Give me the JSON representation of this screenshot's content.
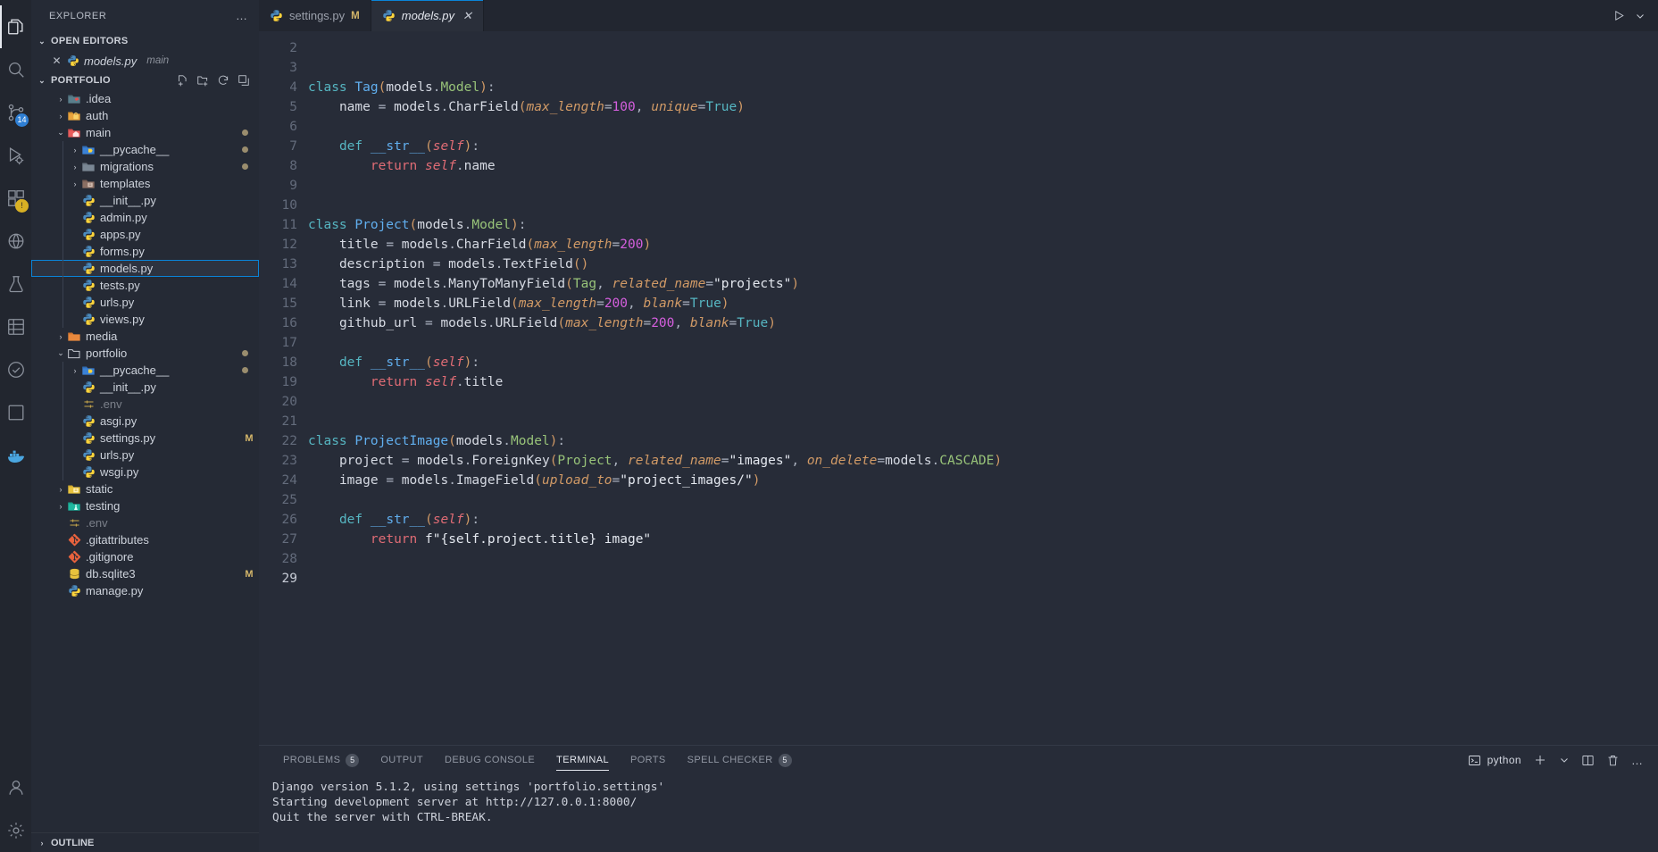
{
  "activity_bar": {
    "items": [
      {
        "name": "explorer",
        "icon": "files-icon",
        "badge": null,
        "active": true
      },
      {
        "name": "search",
        "icon": "search-icon",
        "badge": null,
        "active": false
      },
      {
        "name": "source-control",
        "icon": "source-control-icon",
        "badge": "14",
        "active": false
      },
      {
        "name": "run-and-debug",
        "icon": "run-debug-icon",
        "badge": null,
        "active": false
      },
      {
        "name": "extensions",
        "icon": "extensions-icon",
        "badge": "!",
        "active": false
      },
      {
        "name": "remote-explorer",
        "icon": "remote-explorer-icon",
        "badge": null,
        "active": false
      },
      {
        "name": "testing",
        "icon": "beaker-icon",
        "badge": null,
        "active": false
      },
      {
        "name": "database",
        "icon": "database-icon",
        "badge": null,
        "active": false
      },
      {
        "name": "todo-tree",
        "icon": "check-circle-icon",
        "badge": null,
        "active": false
      },
      {
        "name": "layout",
        "icon": "square-icon",
        "badge": null,
        "active": false
      },
      {
        "name": "docker",
        "icon": "docker-icon",
        "badge": null,
        "active": false
      }
    ],
    "bottom_items": [
      {
        "name": "accounts",
        "icon": "account-icon"
      },
      {
        "name": "settings",
        "icon": "gear-icon"
      }
    ]
  },
  "sidebar": {
    "title": "EXPLORER",
    "more_actions": "…",
    "open_editors": {
      "label": "OPEN EDITORS",
      "items": [
        {
          "close": "✕",
          "icon": "python-icon",
          "name": "models.py",
          "description": "main"
        }
      ]
    },
    "workspace": {
      "label": "PORTFOLIO",
      "actions": [
        "new-file-icon",
        "new-folder-icon",
        "refresh-icon",
        "collapse-all-icon"
      ],
      "tree": [
        {
          "indent": 1,
          "twisty": "›",
          "icon": "folder-idea",
          "label": ".idea",
          "mark": "",
          "dot": false,
          "dim": false,
          "selected": false
        },
        {
          "indent": 1,
          "twisty": "›",
          "icon": "folder-auth",
          "label": "auth",
          "mark": "",
          "dot": false,
          "dim": false,
          "selected": false
        },
        {
          "indent": 1,
          "twisty": "⌄",
          "icon": "folder-main",
          "label": "main",
          "mark": "",
          "dot": true,
          "dim": false,
          "selected": false
        },
        {
          "indent": 2,
          "twisty": "›",
          "icon": "folder-pycache",
          "label": "__pycache__",
          "mark": "",
          "dot": true,
          "dim": false,
          "selected": false
        },
        {
          "indent": 2,
          "twisty": "›",
          "icon": "folder-plain",
          "label": "migrations",
          "mark": "",
          "dot": true,
          "dim": false,
          "selected": false
        },
        {
          "indent": 2,
          "twisty": "›",
          "icon": "folder-templates",
          "label": "templates",
          "mark": "",
          "dot": false,
          "dim": false,
          "selected": false
        },
        {
          "indent": 2,
          "twisty": "",
          "icon": "python-icon",
          "label": "__init__.py",
          "mark": "",
          "dot": false,
          "dim": false,
          "selected": false
        },
        {
          "indent": 2,
          "twisty": "",
          "icon": "python-icon",
          "label": "admin.py",
          "mark": "",
          "dot": false,
          "dim": false,
          "selected": false
        },
        {
          "indent": 2,
          "twisty": "",
          "icon": "python-icon",
          "label": "apps.py",
          "mark": "",
          "dot": false,
          "dim": false,
          "selected": false
        },
        {
          "indent": 2,
          "twisty": "",
          "icon": "python-icon",
          "label": "forms.py",
          "mark": "",
          "dot": false,
          "dim": false,
          "selected": false
        },
        {
          "indent": 2,
          "twisty": "",
          "icon": "python-icon",
          "label": "models.py",
          "mark": "",
          "dot": false,
          "dim": false,
          "selected": true
        },
        {
          "indent": 2,
          "twisty": "",
          "icon": "python-icon",
          "label": "tests.py",
          "mark": "",
          "dot": false,
          "dim": false,
          "selected": false
        },
        {
          "indent": 2,
          "twisty": "",
          "icon": "python-icon",
          "label": "urls.py",
          "mark": "",
          "dot": false,
          "dim": false,
          "selected": false
        },
        {
          "indent": 2,
          "twisty": "",
          "icon": "python-icon",
          "label": "views.py",
          "mark": "",
          "dot": false,
          "dim": false,
          "selected": false
        },
        {
          "indent": 1,
          "twisty": "›",
          "icon": "folder-media",
          "label": "media",
          "mark": "",
          "dot": false,
          "dim": false,
          "selected": false
        },
        {
          "indent": 1,
          "twisty": "⌄",
          "icon": "folder-open",
          "label": "portfolio",
          "mark": "",
          "dot": true,
          "dim": false,
          "selected": false
        },
        {
          "indent": 2,
          "twisty": "›",
          "icon": "folder-pycache",
          "label": "__pycache__",
          "mark": "",
          "dot": true,
          "dim": false,
          "selected": false
        },
        {
          "indent": 2,
          "twisty": "",
          "icon": "python-icon",
          "label": "__init__.py",
          "mark": "",
          "dot": false,
          "dim": false,
          "selected": false
        },
        {
          "indent": 2,
          "twisty": "",
          "icon": "settings-file-icon",
          "label": ".env",
          "mark": "",
          "dot": false,
          "dim": true,
          "selected": false
        },
        {
          "indent": 2,
          "twisty": "",
          "icon": "python-icon",
          "label": "asgi.py",
          "mark": "",
          "dot": false,
          "dim": false,
          "selected": false
        },
        {
          "indent": 2,
          "twisty": "",
          "icon": "python-icon",
          "label": "settings.py",
          "mark": "M",
          "dot": false,
          "dim": false,
          "selected": false
        },
        {
          "indent": 2,
          "twisty": "",
          "icon": "python-icon",
          "label": "urls.py",
          "mark": "",
          "dot": false,
          "dim": false,
          "selected": false
        },
        {
          "indent": 2,
          "twisty": "",
          "icon": "python-icon",
          "label": "wsgi.py",
          "mark": "",
          "dot": false,
          "dim": false,
          "selected": false
        },
        {
          "indent": 1,
          "twisty": "›",
          "icon": "folder-static",
          "label": "static",
          "mark": "",
          "dot": false,
          "dim": false,
          "selected": false
        },
        {
          "indent": 1,
          "twisty": "›",
          "icon": "folder-testing",
          "label": "testing",
          "mark": "",
          "dot": false,
          "dim": false,
          "selected": false
        },
        {
          "indent": 1,
          "twisty": "",
          "icon": "settings-file-icon",
          "label": ".env",
          "mark": "",
          "dot": false,
          "dim": true,
          "selected": false
        },
        {
          "indent": 1,
          "twisty": "",
          "icon": "git-icon",
          "label": ".gitattributes",
          "mark": "",
          "dot": false,
          "dim": false,
          "selected": false
        },
        {
          "indent": 1,
          "twisty": "",
          "icon": "git-icon",
          "label": ".gitignore",
          "mark": "",
          "dot": false,
          "dim": false,
          "selected": false
        },
        {
          "indent": 1,
          "twisty": "",
          "icon": "database-file-icon",
          "label": "db.sqlite3",
          "mark": "M",
          "dot": false,
          "dim": false,
          "selected": false
        },
        {
          "indent": 1,
          "twisty": "",
          "icon": "python-icon",
          "label": "manage.py",
          "mark": "",
          "dot": false,
          "dim": false,
          "selected": false
        }
      ]
    },
    "outline": {
      "label": "OUTLINE"
    }
  },
  "editor": {
    "tabs": [
      {
        "icon": "python-icon",
        "label": "settings.py",
        "mark": "M",
        "close": "",
        "active": false
      },
      {
        "icon": "python-icon",
        "label": "models.py",
        "mark": "",
        "close": "✕",
        "active": true
      }
    ],
    "actions": [
      "run-play-icon",
      "chevron-down-icon"
    ],
    "first_visible_line": 2,
    "last_line": 29,
    "cursor_line": 29,
    "line_numbers": [
      2,
      3,
      4,
      5,
      6,
      7,
      8,
      9,
      10,
      11,
      12,
      13,
      14,
      15,
      16,
      17,
      18,
      19,
      20,
      21,
      22,
      23,
      24,
      25,
      26,
      27,
      28,
      29
    ],
    "code_lines": [
      "",
      "",
      "class Tag(models.Model):",
      "    name = models.CharField(max_length=100, unique=True)",
      "",
      "    def __str__(self):",
      "        return self.name",
      "",
      "",
      "class Project(models.Model):",
      "    title = models.CharField(max_length=200)",
      "    description = models.TextField()",
      "    tags = models.ManyToManyField(Tag, related_name=\"projects\")",
      "    link = models.URLField(max_length=200, blank=True)",
      "    github_url = models.URLField(max_length=200, blank=True)",
      "",
      "    def __str__(self):",
      "        return self.title",
      "",
      "",
      "class ProjectImage(models.Model):",
      "    project = models.ForeignKey(Project, related_name=\"images\", on_delete=models.CASCADE)",
      "    image = models.ImageField(upload_to=\"project_images/\")",
      "",
      "    def __str__(self):",
      "        return f\"{self.project.title} image\"",
      "",
      ""
    ]
  },
  "panel": {
    "tabs": [
      {
        "label": "PROBLEMS",
        "badge": "5",
        "active": false
      },
      {
        "label": "OUTPUT",
        "badge": "",
        "active": false
      },
      {
        "label": "DEBUG CONSOLE",
        "badge": "",
        "active": false
      },
      {
        "label": "TERMINAL",
        "badge": "",
        "active": true
      },
      {
        "label": "PORTS",
        "badge": "",
        "active": false
      },
      {
        "label": "SPELL CHECKER",
        "badge": "5",
        "active": false
      }
    ],
    "terminal_name": "python",
    "actions": [
      "new-terminal-icon",
      "chevron-down-icon",
      "split-terminal-icon",
      "kill-terminal-icon",
      "more-actions-icon"
    ],
    "terminal_output": [
      "Django version 5.1.2, using settings 'portfolio.settings'",
      "Starting development server at http://127.0.0.1:8000/",
      "Quit the server with CTRL-BREAK."
    ]
  },
  "colors": {
    "accent": "#0a84d8",
    "modified": "#d4b66a",
    "badge_blue": "#2f7fd4",
    "badge_warn": "#d8b024",
    "editor_bg": "#272c38",
    "sidebar_bg": "#252a35",
    "activitybar_bg": "#22262f"
  }
}
